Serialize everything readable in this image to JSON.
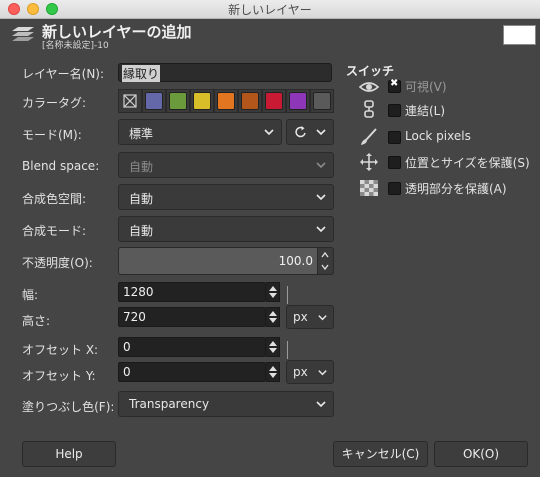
{
  "window_title": "新しいレイヤー",
  "header": {
    "title": "新しいレイヤーの追加",
    "subtitle": "[名称未設定]-10"
  },
  "form": {
    "layer_name_label": "レイヤー名(N):",
    "layer_name_value": "縁取り",
    "color_tag_label": "カラータグ:",
    "color_tags": [
      "none",
      "#6468a8",
      "#6a9a3c",
      "#d8be28",
      "#e27520",
      "#c81a32",
      "#8e36b8",
      "#5a5a5a"
    ],
    "mode_label": "モード(M):",
    "mode_value": "標準",
    "blend_space_label": "Blend space:",
    "blend_space_value": "自動",
    "composite_space_label": "合成色空間:",
    "composite_space_value": "自動",
    "composite_mode_label": "合成モード:",
    "composite_mode_value": "自動",
    "opacity_label": "不透明度(O):",
    "opacity_value": "100.0",
    "width_label": "幅:",
    "width_value": "1280",
    "height_label": "高さ:",
    "height_value": "720",
    "size_unit": "px",
    "offset_x_label": "オフセット X:",
    "offset_x_value": "0",
    "offset_y_label": "オフセット Y:",
    "offset_y_value": "0",
    "offset_unit": "px",
    "fill_label": "塗りつぶし色(F):",
    "fill_value": "Transparency"
  },
  "switches": {
    "title": "スイッチ",
    "items": [
      {
        "label": "可視(V)",
        "checked": true,
        "icon": "eye-icon"
      },
      {
        "label": "連結(L)",
        "checked": false,
        "icon": "chain-icon"
      },
      {
        "label": "Lock pixels",
        "checked": false,
        "icon": "brush-icon"
      },
      {
        "label": "位置とサイズを保護(S)",
        "checked": false,
        "icon": "move-icon"
      },
      {
        "label": "透明部分を保護(A)",
        "checked": false,
        "icon": "checkerboard-icon"
      }
    ]
  },
  "buttons": {
    "help": "Help",
    "cancel": "キャンセル(C)",
    "ok": "OK(O)"
  }
}
